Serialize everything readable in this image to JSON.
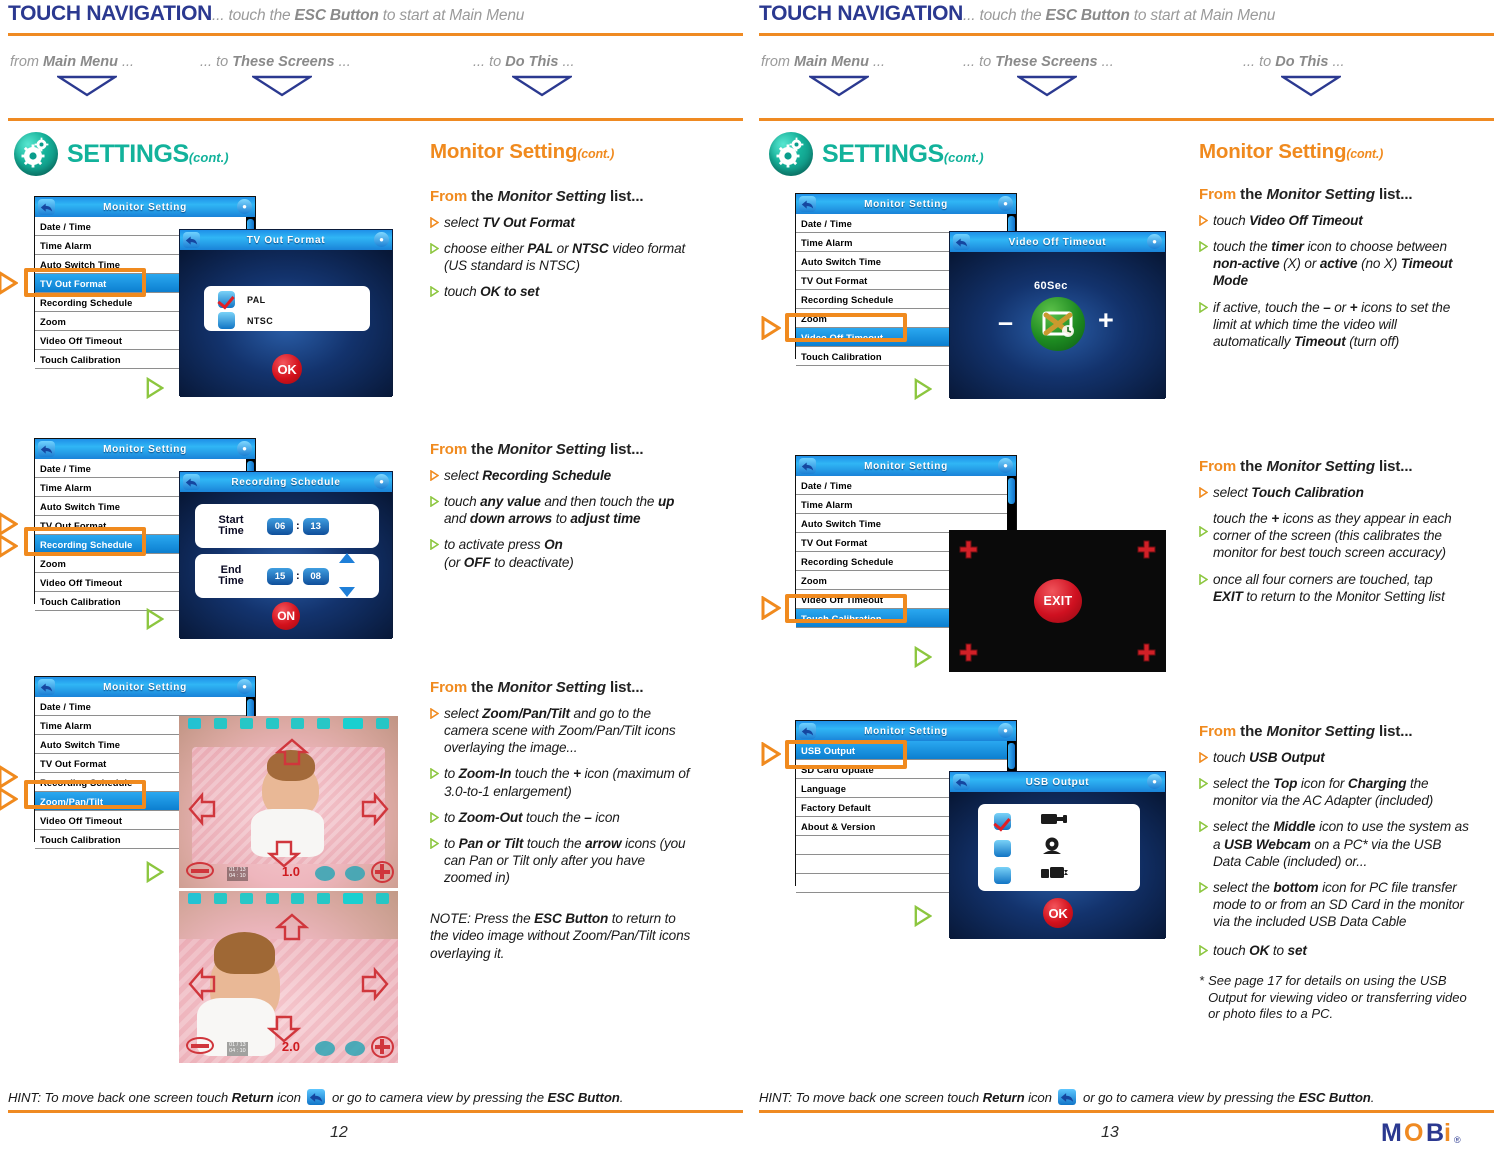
{
  "header": {
    "title": "TOUCH NAVIGATION",
    "subtitle_pre": "... touch the ",
    "subtitle_bold": "ESC Button",
    "subtitle_post": " to start at Main Menu",
    "columns": [
      {
        "pre": "from ",
        "bold": "Main Menu",
        "post": " ..."
      },
      {
        "pre": "... to ",
        "bold": "These Screens",
        "post": " ..."
      },
      {
        "pre": "... to ",
        "bold": "Do This",
        "post": " ..."
      }
    ]
  },
  "section": {
    "settings_label": "SETTINGS",
    "settings_cont": "(cont.)",
    "monitor_title": "Monitor Setting",
    "monitor_cont": "(cont.)",
    "gear_icon": "gear-icon"
  },
  "menu": {
    "title": "Monitor Setting",
    "items_a": [
      "Date / Time",
      "Time Alarm",
      "Auto Switch Time",
      "TV Out Format",
      "Recording Schedule",
      "Zoom",
      "Video Off Timeout",
      "Touch Calibration"
    ],
    "items_b": [
      "Date / Time",
      "Time Alarm",
      "Auto Switch Time",
      "TV Out Format",
      "Recording Schedule",
      "Zoom/Pan/Tilt",
      "Video Off Timeout",
      "Touch Calibration"
    ],
    "items_usb": [
      "USB Output",
      "SD Card Update",
      "Language",
      "Factory Default",
      "About & Version",
      "",
      "",
      ""
    ]
  },
  "left_page": {
    "blocks": [
      {
        "from_f": "From",
        "from_rest": " the ",
        "from_italic": "Monitor Setting",
        "from_tail": " list...",
        "screen_title": "TV Out Format",
        "selected_item": "TV Out Format",
        "dialog": {
          "options": [
            {
              "label": "PAL",
              "checked": true
            },
            {
              "label": "NTSC",
              "checked": false
            }
          ],
          "ok_label": "OK"
        },
        "bullets": [
          {
            "color": "orange",
            "html": "select <b>TV Out Format</b>"
          },
          {
            "color": "green",
            "html": "choose either <b>PAL</b> or <b>NTSC</b> video format (US standard is NTSC)"
          },
          {
            "color": "green",
            "html": "touch <b>OK to set</b>"
          }
        ]
      },
      {
        "screen_title": "Recording Schedule",
        "selected_item": "Recording Schedule",
        "dialog": {
          "start_label": "Start\nTime",
          "end_label": "End\nTime",
          "start_hour": "06",
          "start_min": "13",
          "end_hour": "15",
          "end_min": "08",
          "on_label": "ON"
        },
        "bullets": [
          {
            "color": "orange",
            "html": "select <b>Recording Schedule</b>"
          },
          {
            "color": "green",
            "html": "touch <b>any value</b> and then touch the <b>up</b> and <b>down arrows</b> to <b>adjust time</b>"
          },
          {
            "color": "green",
            "html": "to activate press <b>On</b><br>(or <b>OFF</b> to deactivate)"
          }
        ]
      },
      {
        "selected_item": "Zoom/Pan/Tilt",
        "cam_zoom_1": "1.0",
        "cam_zoom_2": "2.0",
        "cam_time_1": "01 / 13",
        "cam_time_2": "04 : 10",
        "bullets": [
          {
            "color": "orange",
            "html": "select <b>Zoom/Pan/Tilt</b> and go to the camera scene with Zoom/Pan/Tilt icons overlaying the image..."
          },
          {
            "color": "green",
            "html": "to <b>Zoom-In</b> touch the <b>+</b> icon (maximum of 3.0-to-1 enlargement)"
          },
          {
            "color": "green",
            "html": "to <b>Zoom-Out</b> touch the <b>&ndash;</b> icon"
          },
          {
            "color": "green",
            "html": "to <b>Pan or Tilt</b> touch the <b>arrow</b> icons (you can Pan or Tilt only after you have zoomed in)"
          }
        ],
        "note": "NOTE: Press the <b>ESC Button</b> to return to the video image without Zoom/Pan/Tilt icons overlaying it."
      }
    ],
    "hint_pre": "HINT: To move back one screen touch ",
    "hint_bold1": "Return",
    "hint_mid": " icon ",
    "hint_mid2": " or go to camera view by pressing the ",
    "hint_bold2": "ESC Button",
    "hint_end": ".",
    "page_number": "12"
  },
  "right_page": {
    "blocks": [
      {
        "screen_title": "Video Off Timeout",
        "selected_item": "Video Off Timeout",
        "dialog": {
          "seconds_label": "60Sec",
          "minus": "–",
          "plus": "+"
        },
        "bullets": [
          {
            "color": "orange",
            "html": "touch <b>Video Off Timeout</b>"
          },
          {
            "color": "green",
            "html": "touch the <b>timer</b> icon to choose between <b>non-active</b> (X) or <b>active</b> (no X) <b>Timeout Mode</b>"
          },
          {
            "color": "green",
            "html": "if active, touch the <b>&ndash;</b> or <b>+</b> icons to set the limit at which time the video will automatically <b>Timeout</b> (turn off)"
          }
        ]
      },
      {
        "selected_item": "Touch Calibration",
        "dialog": {
          "exit_label": "EXIT"
        },
        "bullets": [
          {
            "color": "orange",
            "html": "select <b>Touch Calibration</b>"
          },
          {
            "color": "green",
            "html": "touch the <b>+</b> icons as they appear in each corner of the screen (this calibrates the monitor for best touch screen accuracy)"
          },
          {
            "color": "green",
            "html": "once all four corners are touched, tap <b>EXIT</b> to return to the Monitor Setting list"
          }
        ]
      },
      {
        "screen_title": "USB Output",
        "selected_item": "USB Output",
        "dialog": {
          "options": [
            {
              "icon": "ac-adapter-icon",
              "checked": true
            },
            {
              "icon": "webcam-icon",
              "checked": false
            },
            {
              "icon": "usb-transfer-icon",
              "checked": false
            }
          ],
          "ok_label": "OK"
        },
        "bullets": [
          {
            "color": "orange",
            "html": "touch <b>USB Output</b>"
          },
          {
            "color": "green",
            "html": "select the <b>Top</b> icon for <b>Charging</b> the monitor via the AC Adapter (included)"
          },
          {
            "color": "green",
            "html": "select the <b>Middle</b> icon to use the system as a <b>USB Webcam</b> on a PC* via the USB Data Cable (included) or..."
          },
          {
            "color": "green",
            "html": "select the <b>bottom</b> icon for PC file transfer mode to or from an SD Card in the monitor via the included USB Data Cable"
          },
          {
            "color": "green",
            "html": "touch <b>OK</b> to <b>set</b>"
          }
        ],
        "footnote_mark": "*",
        "footnote": "See page 17 for details on using the USB Output for viewing video or transferring video or photo files to a PC."
      }
    ],
    "hint_pre": "HINT: To move back one screen touch ",
    "hint_bold1": "Return",
    "hint_mid": " icon ",
    "hint_mid2": " or go to camera view by pressing the ",
    "hint_bold2": "ESC Button",
    "hint_end": ".",
    "page_number": "13",
    "logo_text": "MOBi"
  },
  "colors": {
    "brand_blue": "#2b3990",
    "orange": "#ef8a22",
    "teal": "#12b29b",
    "green_bullet": "#8cc63f",
    "orange_bullet": "#f08a1e"
  }
}
